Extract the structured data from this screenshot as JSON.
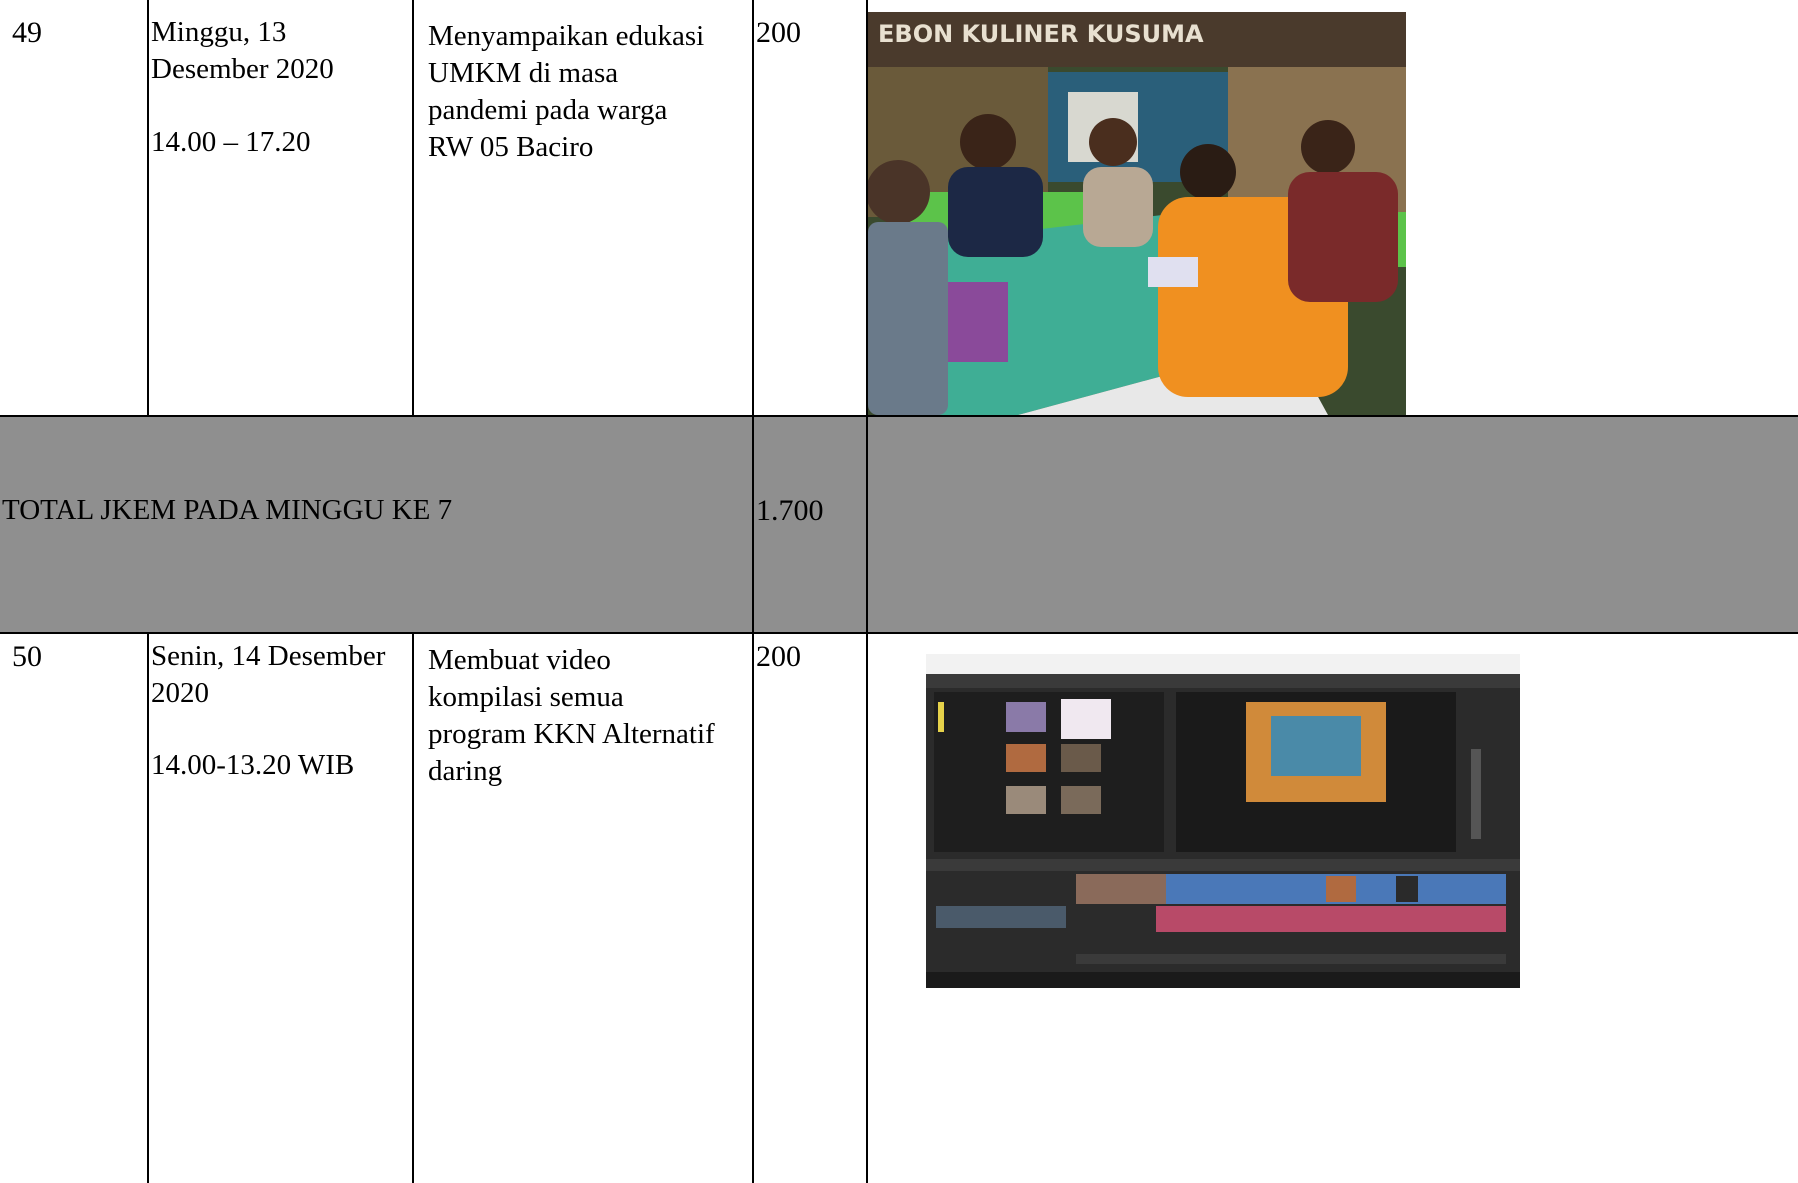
{
  "rows": [
    {
      "no": "49",
      "date": "Minggu, 13\nDesember 2020",
      "time": "14.00 – 17.20",
      "activity": "Menyampaikan edukasi\nUMKM di masa\npandemi pada  warga\nRW 05 Baciro",
      "jkem": "200",
      "photo_sign": "EBON   KULINER KUSUMA"
    },
    {
      "no": "50",
      "date": "Senin, 14 Desember\n2020",
      "time": "14.00-13.20 WIB",
      "activity": "Membuat video\nkompilasi semua\nprogram KKN Alternatif\ndaring",
      "jkem": "200"
    }
  ],
  "total": {
    "label": "TOTAL JKEM PADA MINGGU KE 7",
    "value": "1.700"
  },
  "colors": {
    "total_row_bg": "#8f8f8f",
    "border": "#000000"
  }
}
